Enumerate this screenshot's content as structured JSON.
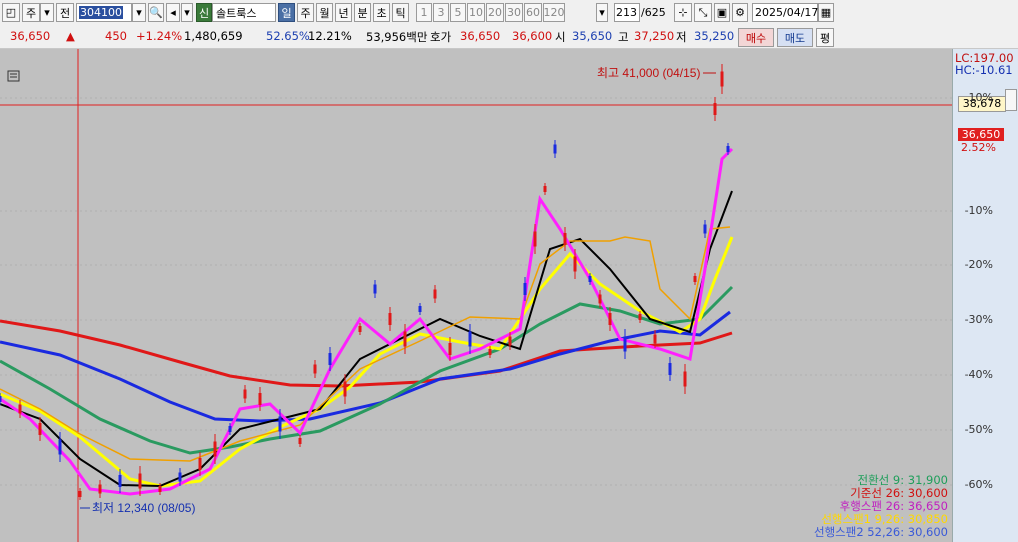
{
  "toolbar": {
    "label_ju": "주",
    "label_jeon": "전",
    "code_value": "304100",
    "company": "솔트룩스",
    "tag_sin": "신",
    "periods": [
      "일",
      "주",
      "월",
      "년",
      "분",
      "초",
      "틱"
    ],
    "intervals": [
      "1",
      "3",
      "5",
      "10",
      "20",
      "30",
      "60",
      "120"
    ],
    "count": "213",
    "count_total": "/625",
    "date": "2025/04/17"
  },
  "quote": {
    "price": "36,650",
    "change_sign": "▲",
    "change": "450",
    "change_pct": "+1.24%",
    "volume": "1,480,659",
    "vol_ratio": "52.65%",
    "turnover": "12.21%",
    "amount": "53,956백만",
    "label_hoga": "호가",
    "hoga_sell": "36,650",
    "hoga_buy": "36,600",
    "label_si": "시",
    "open": "35,650",
    "label_go": "고",
    "high": "37,250",
    "label_jeo": "저",
    "low": "35,250",
    "btn_buy": "매수",
    "btn_sell": "매도",
    "btn_eval": "평"
  },
  "axis": {
    "lc": "LC:197.00",
    "hc": "HC:-10.61",
    "cross_value": "38,678",
    "price_tag": "36,650",
    "price_pct": "2.52%",
    "ticks": [
      "10%",
      "-10%",
      "-20%",
      "-30%",
      "-40%",
      "-50%",
      "-60%"
    ]
  },
  "annotations": {
    "high": "최고 41,000 (04/15)",
    "low": "최저 12,340 (08/05)"
  },
  "legend": [
    {
      "text": "전환선 9: 31,900",
      "color": "#1e9e5a"
    },
    {
      "text": "기준선 26: 30,600",
      "color": "#d01010"
    },
    {
      "text": "후행스팬 26: 36,650",
      "color": "#c020c0"
    },
    {
      "text": "선행스팬1 9,26: 30,850",
      "color": "#ffd800"
    },
    {
      "text": "선행스팬2 52,26: 30,600",
      "color": "#3a5ad8"
    }
  ]
}
